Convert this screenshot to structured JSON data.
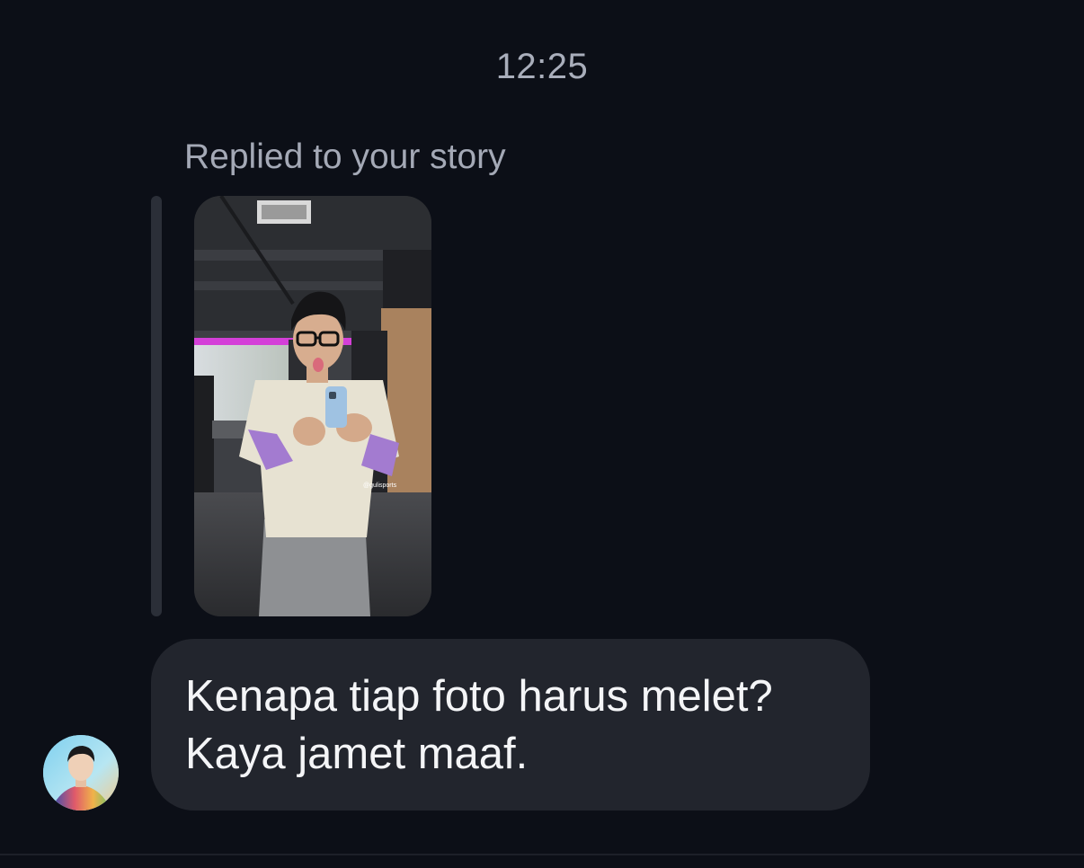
{
  "chat": {
    "timestamp": "12:25",
    "reply_label": "Replied to your story",
    "story": {
      "watermark": "@gulisports"
    },
    "message": {
      "line1": "Kenapa tiap foto harus melet?",
      "line2": "Kaya jamet maaf."
    }
  },
  "colors": {
    "background": "#0c0f17",
    "bubble": "#22252d",
    "text": "#f4f5f7",
    "muted_text": "#a4a9b6"
  }
}
